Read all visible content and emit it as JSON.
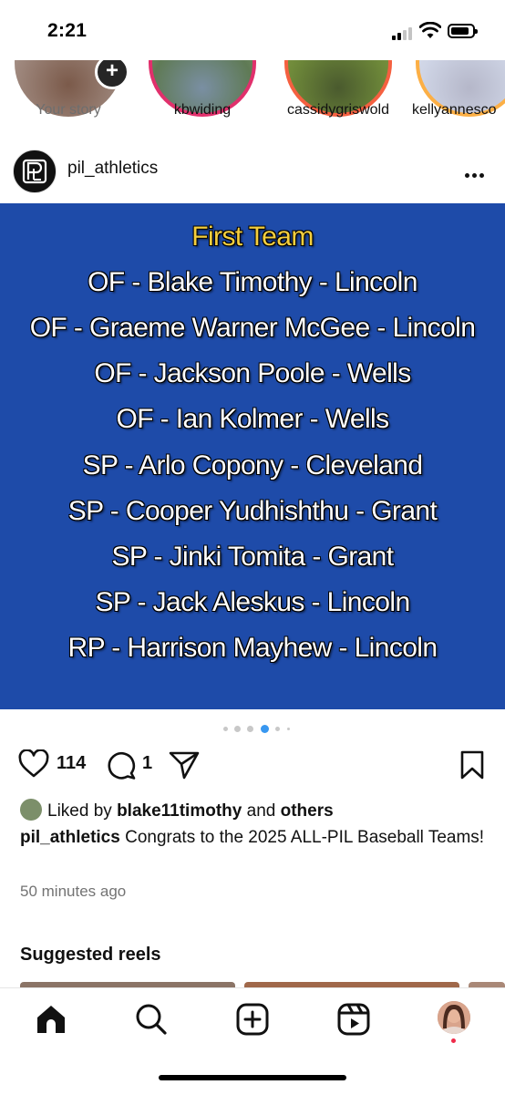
{
  "status_bar": {
    "time": "2:21"
  },
  "stories": [
    {
      "label": "Your story",
      "own": true
    },
    {
      "label": "kbwiding"
    },
    {
      "label": "cassidygriswold"
    },
    {
      "label": "kellyannesco"
    }
  ],
  "post": {
    "username": "pil_athletics",
    "image_lines": [
      "First Team",
      "OF - Blake Timothy - Lincoln",
      "OF - Graeme Warner McGee - Lincoln",
      "OF - Jackson Poole - Wells",
      "OF - Ian Kolmer - Wells",
      "SP - Arlo Copony - Cleveland",
      "SP - Cooper Yudhishthu - Grant",
      "SP - Jinki Tomita - Grant",
      "SP - Jack Aleskus - Lincoln",
      "RP - Harrison Mayhew - Lincoln"
    ],
    "carousel": {
      "count": 6,
      "active_index": 3
    },
    "likes": "114",
    "comments": "1",
    "liked_by_prefix": "Liked by",
    "liked_by_user": "blake11timothy",
    "liked_by_and": "and",
    "liked_by_others": "others",
    "caption_user": "pil_athletics",
    "caption_text": "Congrats to the 2025 ALL-PIL Baseball Teams!",
    "time_ago": "50 minutes ago"
  },
  "suggested_reels_title": "Suggested reels",
  "colors": {
    "image_bg": "#1e4ba9",
    "heading_yellow": "#f5cf3e",
    "active_dot": "#3897f0",
    "notification_dot": "#ef2b4a"
  },
  "bottom_nav": {
    "items": [
      {
        "name": "home-icon"
      },
      {
        "name": "search-icon"
      },
      {
        "name": "create-icon"
      },
      {
        "name": "reels-icon"
      },
      {
        "name": "profile-avatar"
      }
    ]
  }
}
